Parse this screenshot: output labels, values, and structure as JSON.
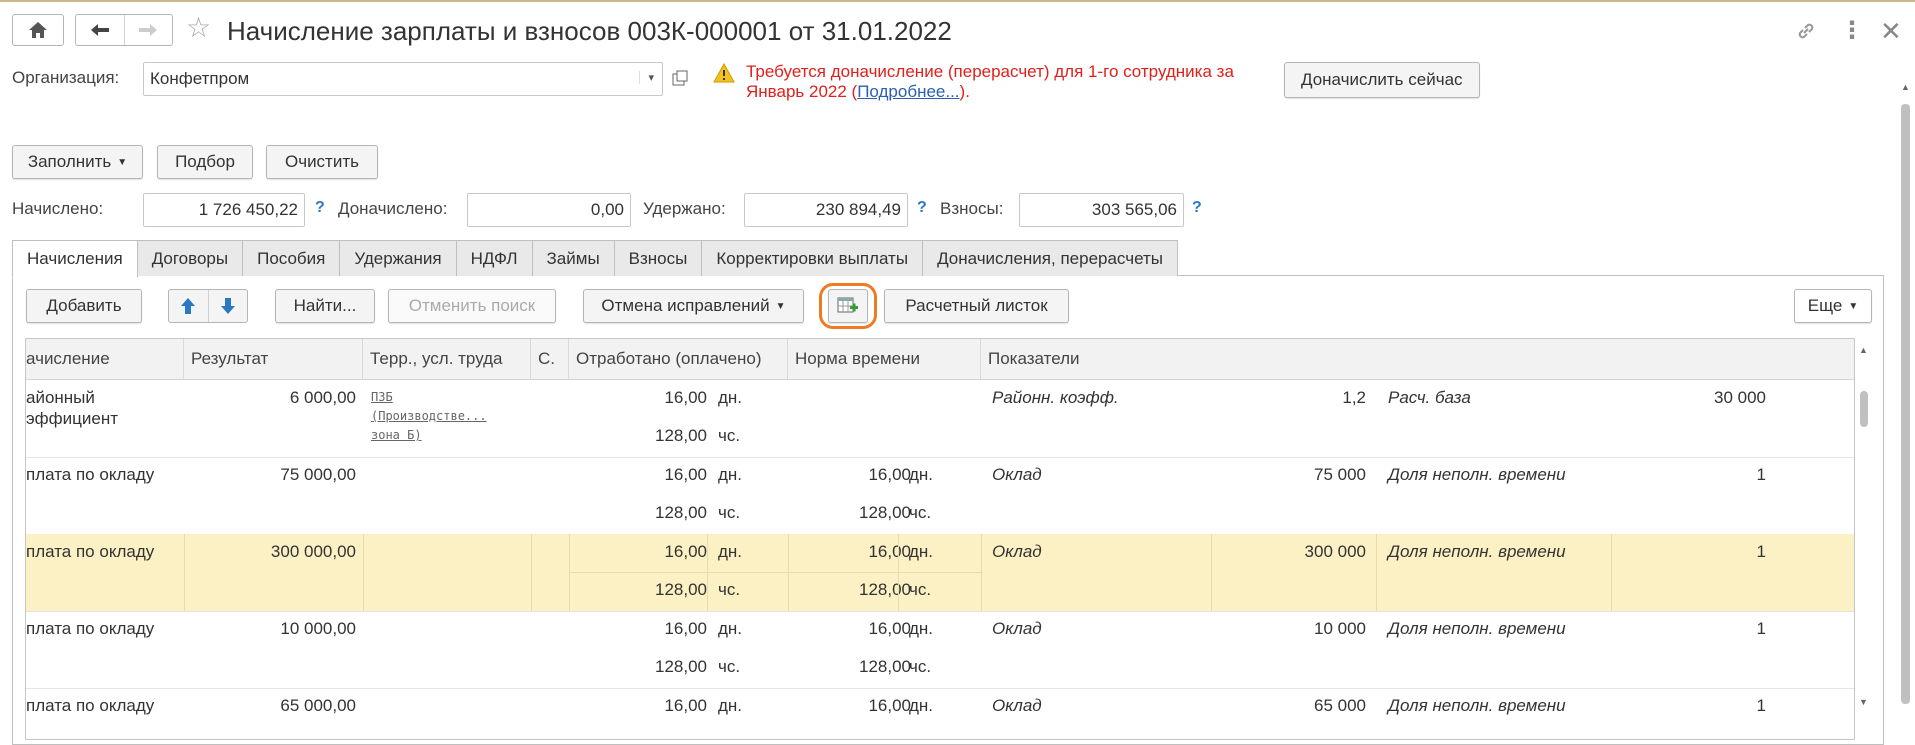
{
  "window": {
    "title": "Начисление зарплаты и взносов 003К-000001 от 31.01.2022"
  },
  "org": {
    "label": "Организация:",
    "value": "Конфетпром"
  },
  "warning": {
    "line1": "Требуется доначисление (перерасчет) для 1-го сотрудника за",
    "line2_prefix": "Январь 2022 (",
    "link": "Подробнее...",
    "line2_suffix": ").",
    "color": "#e0201c"
  },
  "buttons": {
    "recalc_now": "Доначислить сейчас",
    "fill": "Заполнить",
    "select": "Подбор",
    "clear": "Очистить",
    "add": "Добавить",
    "find": "Найти...",
    "cancel_search": "Отменить поиск",
    "cancel_corrections": "Отмена исправлений",
    "payslip": "Расчетный листок",
    "more": "Еще"
  },
  "totals": {
    "accrued_label": "Начислено:",
    "accrued_value": "1 726 450,22",
    "extra_label": "Доначислено:",
    "extra_value": "0,00",
    "withheld_label": "Удержано:",
    "withheld_value": "230 894,49",
    "contrib_label": "Взносы:",
    "contrib_value": "303 565,06",
    "help": "?"
  },
  "tabs": [
    "Начисления",
    "Договоры",
    "Пособия",
    "Удержания",
    "НДФЛ",
    "Займы",
    "Взносы",
    "Корректировки выплаты",
    "Доначисления, перерасчеты"
  ],
  "grid": {
    "headers": [
      "ачисление",
      "Результат",
      "Терр., усл. труда",
      "С.",
      "Отработано (оплачено)",
      "Норма времени",
      "Показатели"
    ],
    "rows": [
      {
        "name1": "айонный",
        "name2": "эффициент",
        "result": "6 000,00",
        "terr1": "ПЗБ",
        "terr2": "(Производстве...",
        "terr3": "зона Б)",
        "worked_days": "16,00",
        "days_unit": "дн.",
        "worked_hours": "128,00",
        "hours_unit": "чс.",
        "norm_days": "",
        "norm_days_unit": "",
        "norm_hours": "",
        "norm_hours_unit": "",
        "ind1_name": "Районн. коэфф.",
        "ind1_value": "1,2",
        "ind2_name": "Расч. база",
        "ind2_value": "30 000"
      },
      {
        "name1": "плата по окладу",
        "name2": "",
        "result": "75 000,00",
        "terr1": "",
        "terr2": "",
        "terr3": "",
        "worked_days": "16,00",
        "days_unit": "дн.",
        "worked_hours": "128,00",
        "hours_unit": "чс.",
        "norm_days": "16,00",
        "norm_days_unit": "дн.",
        "norm_hours": "128,00",
        "norm_hours_unit": "чс.",
        "ind1_name": "Оклад",
        "ind1_value": "75 000",
        "ind2_name": "Доля неполн. времени",
        "ind2_value": "1"
      },
      {
        "name1": "плата по окладу",
        "name2": "",
        "result": "300 000,00",
        "terr1": "",
        "terr2": "",
        "terr3": "",
        "worked_days": "16,00",
        "days_unit": "дн.",
        "worked_hours": "128,00",
        "hours_unit": "чс.",
        "norm_days": "16,00",
        "norm_days_unit": "дн.",
        "norm_hours": "128,00",
        "norm_hours_unit": "чс.",
        "ind1_name": "Оклад",
        "ind1_value": "300 000",
        "ind2_name": "Доля неполн. времени",
        "ind2_value": "1"
      },
      {
        "name1": "плата по окладу",
        "name2": "",
        "result": "10 000,00",
        "terr1": "",
        "terr2": "",
        "terr3": "",
        "worked_days": "16,00",
        "days_unit": "дн.",
        "worked_hours": "128,00",
        "hours_unit": "чс.",
        "norm_days": "16,00",
        "norm_days_unit": "дн.",
        "norm_hours": "128,00",
        "norm_hours_unit": "чс.",
        "ind1_name": "Оклад",
        "ind1_value": "10 000",
        "ind2_name": "Доля неполн. времени",
        "ind2_value": "1"
      },
      {
        "name1": "плата по окладу",
        "name2": "",
        "result": "65 000,00",
        "terr1": "",
        "terr2": "",
        "terr3": "",
        "worked_days": "16,00",
        "days_unit": "дн.",
        "worked_hours": "",
        "hours_unit": "",
        "norm_days": "16,00",
        "norm_days_unit": "дн.",
        "norm_hours": "",
        "norm_hours_unit": "",
        "ind1_name": "Оклад",
        "ind1_value": "65 000",
        "ind2_name": "Доля неполн. времени",
        "ind2_value": "1"
      }
    ]
  },
  "colors": {
    "selected_row": "#fbf1c4",
    "highlight_ring": "#ee7a22",
    "arrow_blue": "#2b78c2"
  }
}
